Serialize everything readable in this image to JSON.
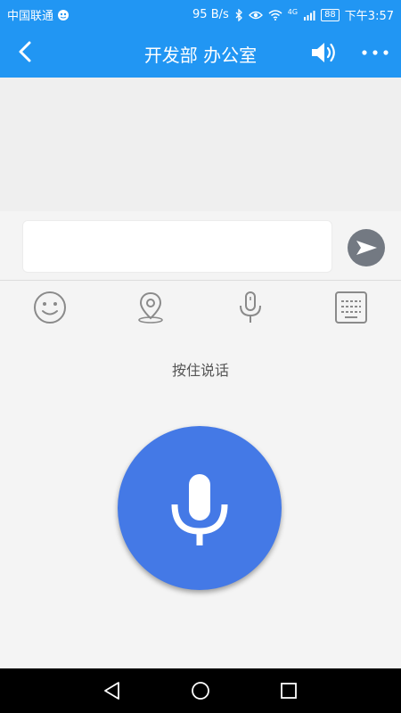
{
  "status_bar": {
    "carrier": "中国联通",
    "speed": "95 B/s",
    "network": "4G",
    "battery": "88",
    "time": "下午3:57"
  },
  "header": {
    "title": "开发部 办公室",
    "icons": [
      "back-icon",
      "speaker-icon",
      "more-icon"
    ]
  },
  "input": {
    "value": "",
    "placeholder": ""
  },
  "toolbar": {
    "icons": [
      "emoji-icon",
      "location-icon",
      "microphone-icon",
      "keyboard-icon"
    ]
  },
  "voice": {
    "hold_label": "按住说话"
  },
  "colors": {
    "primary": "#2196f3",
    "mic_button": "#4479e6",
    "send_button": "#737982"
  }
}
